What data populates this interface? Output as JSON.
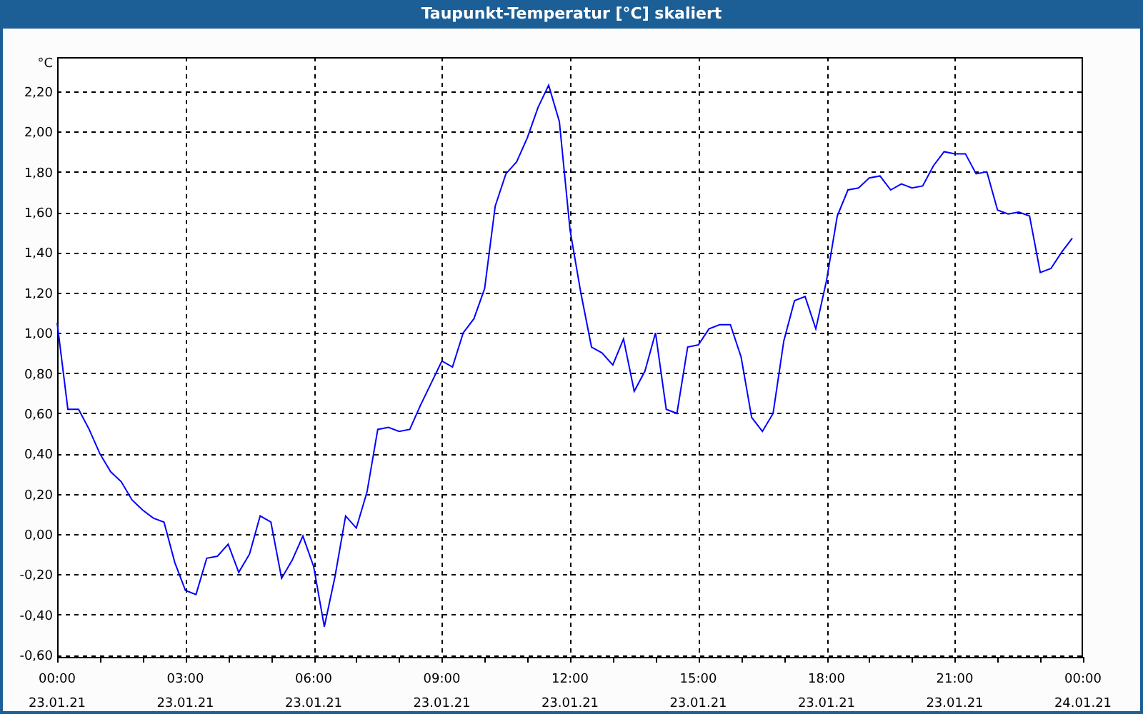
{
  "window": {
    "title": "Taupunkt-Temperatur [°C] skaliert"
  },
  "chart": {
    "chart_data": {
      "type": "line",
      "grid": true,
      "ylabel": "°C",
      "ylim": [
        -0.61,
        2.37
      ],
      "yticks": [
        {
          "value": 2.2,
          "label": "2,20"
        },
        {
          "value": 2.0,
          "label": "2,00"
        },
        {
          "value": 1.8,
          "label": "1,80"
        },
        {
          "value": 1.6,
          "label": "1,60"
        },
        {
          "value": 1.4,
          "label": "1,40"
        },
        {
          "value": 1.2,
          "label": "1,20"
        },
        {
          "value": 1.0,
          "label": "1,00"
        },
        {
          "value": 0.8,
          "label": "0,80"
        },
        {
          "value": 0.6,
          "label": "0,60"
        },
        {
          "value": 0.4,
          "label": "0,40"
        },
        {
          "value": 0.2,
          "label": "0,20"
        },
        {
          "value": 0.0,
          "label": "0,00"
        },
        {
          "value": -0.2,
          "label": "-0,20"
        },
        {
          "value": -0.4,
          "label": "-0,40"
        },
        {
          "value": -0.6,
          "label": "-0,60"
        }
      ],
      "categories": [
        "00:00 23.01.21",
        null,
        null,
        null,
        null,
        null,
        null,
        null,
        null,
        null,
        null,
        null,
        "03:00 23.01.21",
        null,
        null,
        null,
        null,
        null,
        null,
        null,
        null,
        null,
        null,
        null,
        "06:00 23.01.21",
        null,
        null,
        null,
        null,
        null,
        null,
        null,
        null,
        null,
        null,
        null,
        "09:00 23.01.21",
        null,
        null,
        null,
        null,
        null,
        null,
        null,
        null,
        null,
        null,
        null,
        "12:00 23.01.21",
        null,
        null,
        null,
        null,
        null,
        null,
        null,
        null,
        null,
        null,
        null,
        "15:00 23.01.21",
        null,
        null,
        null,
        null,
        null,
        null,
        null,
        null,
        null,
        null,
        null,
        "18:00 23.01.21",
        null,
        null,
        null,
        null,
        null,
        null,
        null,
        null,
        null,
        null,
        null,
        "21:00 23.01.21",
        null,
        null,
        null,
        null,
        null,
        null,
        null,
        null,
        null,
        null,
        null,
        "00:00 24.01.21"
      ],
      "series": [
        {
          "color": "#0000ff",
          "values": [
            1.05,
            0.62,
            0.62,
            0.52,
            0.4,
            0.31,
            0.26,
            0.17,
            0.12,
            0.08,
            0.06,
            -0.14,
            -0.28,
            -0.3,
            -0.12,
            -0.11,
            -0.05,
            -0.19,
            -0.1,
            0.09,
            0.06,
            -0.22,
            -0.13,
            -0.01,
            -0.16,
            -0.46,
            -0.21,
            0.09,
            0.03,
            0.21,
            0.52,
            0.53,
            0.51,
            0.52,
            0.64,
            0.75,
            0.86,
            0.83,
            1.0,
            1.07,
            1.22,
            1.63,
            1.79,
            1.85,
            1.97,
            2.12,
            2.23,
            2.05,
            1.51,
            1.2,
            0.93,
            0.9,
            0.84,
            0.97,
            0.71,
            0.81,
            1.0,
            0.62,
            0.6,
            0.93,
            0.94,
            1.02,
            1.04,
            1.04,
            0.88,
            0.58,
            0.51,
            0.6,
            0.96,
            1.16,
            1.18,
            1.02,
            1.26,
            1.58,
            1.71,
            1.72,
            1.77,
            1.78,
            1.71,
            1.74,
            1.72,
            1.73,
            1.83,
            1.9,
            1.89,
            1.89,
            1.79,
            1.8,
            1.61,
            1.59,
            1.6,
            1.58,
            1.3,
            1.32,
            1.4,
            1.47,
            null
          ]
        }
      ]
    }
  }
}
